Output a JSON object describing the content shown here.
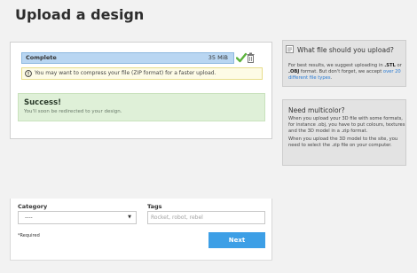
{
  "page": {
    "title": "Upload a design"
  },
  "upload": {
    "file_status": "Complete",
    "file_size": "35 MiB",
    "warning": "You may want to compress your file (ZIP format) for a faster upload.",
    "success_title": "Success!",
    "success_sub": "You'll soon be redirected to your design."
  },
  "sidebar": {
    "box1": {
      "title": "What file should you upload?",
      "text_prefix": "For best results, we suggest uploading in ",
      "stl": ".STL",
      "or": " or ",
      "obj": ".OBJ",
      "text_mid": " format. But don't forget, we accept ",
      "link": "over 20 different file types",
      "text_end": "."
    },
    "box2": {
      "title": "Need multicolor?",
      "p1": "When you upload your 3D file with some formats, for instance .obj, you have to put colours, textures and the 3D model in a .zip format.",
      "p2": "When you upload the 3D model to the site, you need to select the .zip file on your computer."
    }
  },
  "form": {
    "category_label": "Category",
    "category_value": "----",
    "tags_label": "Tags",
    "tags_placeholder": "Rocket, robot, rebel",
    "required_note": "*Required",
    "next_label": "Next"
  },
  "colors": {
    "accent": "#3d9fe6",
    "success_bg": "#dff0d8",
    "progress_bg": "#b9d6f2",
    "check_green": "#5cb33d"
  }
}
